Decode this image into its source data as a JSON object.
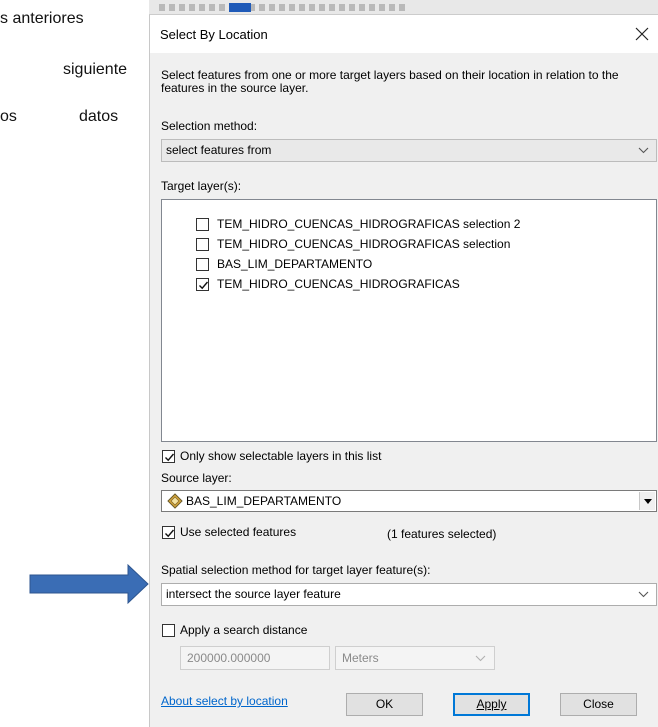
{
  "background_text": {
    "line1": "s anteriores",
    "line2": "siguiente",
    "line3a": "os",
    "line3b": "datos"
  },
  "dialog": {
    "title": "Select By Location",
    "description": "Select features from one or more target layers based on their location in relation to the features in the source layer.",
    "selection_method_label": "Selection method:",
    "selection_method_value": "select features from",
    "target_layers_label": "Target layer(s):",
    "target_layers": [
      {
        "label": "TEM_HIDRO_CUENCAS_HIDROGRAFICAS selection 2",
        "checked": false
      },
      {
        "label": "TEM_HIDRO_CUENCAS_HIDROGRAFICAS selection",
        "checked": false
      },
      {
        "label": "BAS_LIM_DEPARTAMENTO",
        "checked": false
      },
      {
        "label": "TEM_HIDRO_CUENCAS_HIDROGRAFICAS",
        "checked": true
      }
    ],
    "only_selectable_label": "Only show selectable layers in this list",
    "only_selectable_checked": true,
    "source_layer_label": "Source layer:",
    "source_layer_value": "BAS_LIM_DEPARTAMENTO",
    "use_selected_label": "Use selected features",
    "use_selected_checked": true,
    "features_selected_text": "(1 features selected)",
    "spatial_method_label": "Spatial selection method for target layer feature(s):",
    "spatial_method_value": "intersect the source layer feature",
    "apply_distance_label": "Apply a search distance",
    "apply_distance_checked": false,
    "distance_value": "200000.000000",
    "distance_unit": "Meters",
    "about_link": "About select by location",
    "ok_label": "OK",
    "apply_label": "Apply",
    "close_label": "Close"
  },
  "colors": {
    "dialog_bg": "#f0f0f0",
    "link": "#0066cc",
    "arrow": "#3a6db5",
    "default_button_border": "#0078d7"
  }
}
